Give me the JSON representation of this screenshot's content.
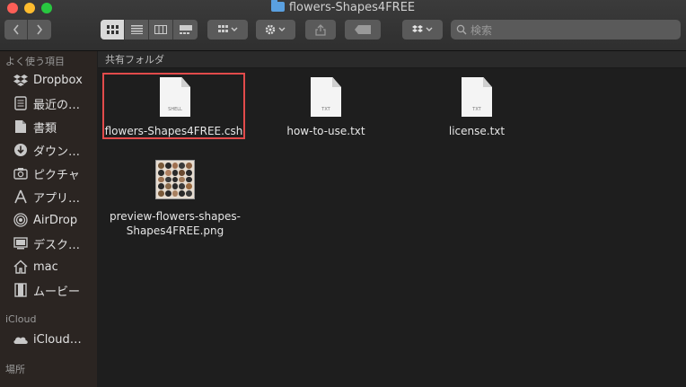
{
  "window": {
    "title": "flowers-Shapes4FREE"
  },
  "toolbar": {
    "search_placeholder": "検索"
  },
  "sidebar": {
    "favorites_header": "よく使う項目",
    "favorites": [
      {
        "label": "Dropbox",
        "icon": "dropbox-icon"
      },
      {
        "label": "最近の…",
        "icon": "recents-icon"
      },
      {
        "label": "書類",
        "icon": "documents-icon"
      },
      {
        "label": "ダウン…",
        "icon": "downloads-icon"
      },
      {
        "label": "ピクチャ",
        "icon": "pictures-icon"
      },
      {
        "label": "アプリ…",
        "icon": "applications-icon"
      },
      {
        "label": "AirDrop",
        "icon": "airdrop-icon"
      },
      {
        "label": "デスク…",
        "icon": "desktop-icon"
      },
      {
        "label": "mac",
        "icon": "home-icon"
      },
      {
        "label": "ムービー",
        "icon": "movies-icon"
      }
    ],
    "icloud_header": "iCloud",
    "icloud": [
      {
        "label": "iCloud…",
        "icon": "cloud-icon"
      }
    ],
    "locations_header": "場所"
  },
  "main": {
    "header": "共有フォルダ",
    "files": [
      {
        "name": "flowers-Shapes4FREE.csh",
        "type_label": "SHELL",
        "selected": true
      },
      {
        "name": "how-to-use.txt",
        "type_label": "TXT"
      },
      {
        "name": "license.txt",
        "type_label": "TXT"
      },
      {
        "name_line1": "preview-flowers-shapes-",
        "name_line2": "Shapes4FREE.png"
      }
    ]
  },
  "colors": {
    "selection": "#e24b4b",
    "sidebar_bg": "#2b2522",
    "main_bg": "#1e1e1e"
  }
}
